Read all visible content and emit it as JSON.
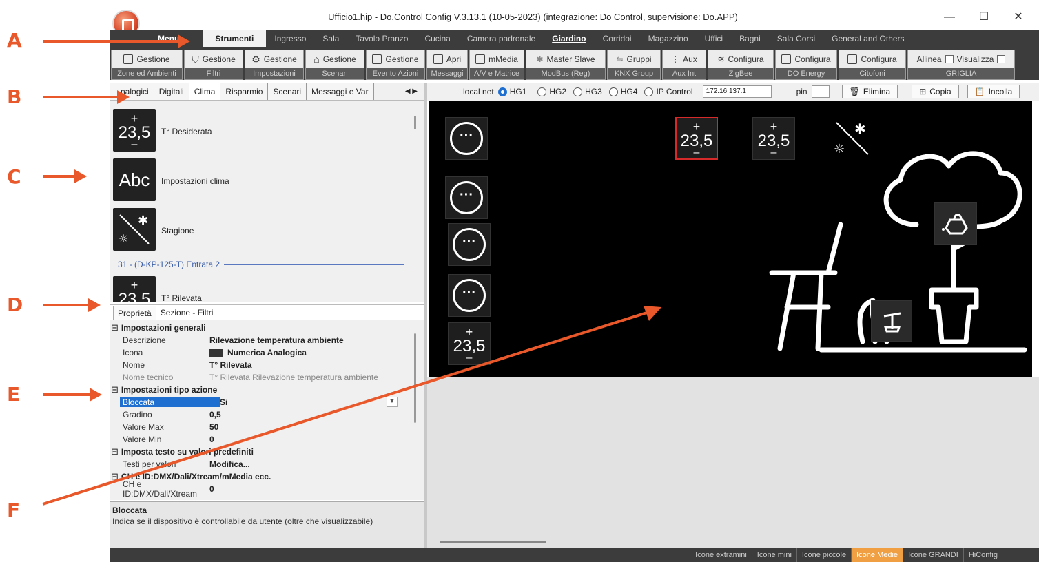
{
  "window": {
    "title": "Ufficio1.hip - Do.Control Config V.3.13.1 (10-05-2023) (integrazione: Do Control, supervisione: Do.APP)",
    "minimize": "—",
    "maximize": "☐",
    "close": "✕"
  },
  "callouts": [
    "A",
    "B",
    "C",
    "D",
    "E",
    "F"
  ],
  "menubar": {
    "menu": "Menu",
    "tabs": [
      "Strumenti",
      "Ingresso",
      "Sala",
      "Tavolo Pranzo",
      "Cucina",
      "Camera padronale",
      "Giardino",
      "Corridoi",
      "Magazzino",
      "Uffici",
      "Bagni",
      "Sala Corsi",
      "General and Others"
    ]
  },
  "toolbar": [
    {
      "top": "Gestione",
      "bottom": "Zone ed Ambienti",
      "icon": "grid-icon"
    },
    {
      "top": "Gestione",
      "bottom": "Filtri",
      "icon": "filter-icon"
    },
    {
      "top": "Gestione",
      "bottom": "Impostazioni",
      "icon": "gear-icon"
    },
    {
      "top": "Gestione",
      "bottom": "Scenari",
      "icon": "house-icon"
    },
    {
      "top": "Gestione",
      "bottom": "Evento Azioni",
      "icon": "event-icon"
    },
    {
      "top": "Apri",
      "bottom": "Messaggi",
      "icon": "message-icon"
    },
    {
      "top": "mMedia",
      "bottom": "A/V e Matrice",
      "icon": "media-icon"
    },
    {
      "top": "Master   Slave",
      "bottom": "ModBus (Reg)",
      "icon": "modbus-icon"
    },
    {
      "top": "Gruppi",
      "bottom": "KNX Group",
      "icon": "knx-icon"
    },
    {
      "top": "Aux",
      "bottom": "Aux Int",
      "icon": "aux-icon"
    },
    {
      "top": "Configura",
      "bottom": "ZigBee",
      "icon": "wifi-icon"
    },
    {
      "top": "Configura",
      "bottom": "DO Energy",
      "icon": "energy-icon"
    },
    {
      "top": "Configura",
      "bottom": "Citofoni",
      "icon": "intercom-icon"
    },
    {
      "top": "Allinea",
      "top2": "Visualizza",
      "bottom": "GRIGLIA",
      "icon": "checkbox"
    }
  ],
  "lefttabs": [
    "nalogici",
    "Digitali",
    "Clima",
    "Risparmio",
    "Scenari",
    "Messaggi e Var"
  ],
  "lefttabs_nav": "◀ ▶",
  "list": {
    "tile_number": "23,5",
    "tile_abc": "Abc",
    "items": [
      "T° Desiderata",
      "Impostazioni clima",
      "Stagione"
    ],
    "group_header": "31 - (D-KP-125-T) Entrata 2",
    "last_item": "T° Rilevata"
  },
  "proptabs": [
    "Proprietà",
    "Sezione - Filtri"
  ],
  "props": {
    "sec1": "Impostazioni generali",
    "descrizione_k": "Descrizione",
    "descrizione_v": "Rilevazione temperatura ambiente",
    "icona_k": "Icona",
    "icona_v": "Numerica Analogica",
    "nome_k": "Nome",
    "nome_v": "T° Rilevata",
    "nometec_k": "Nome tecnico",
    "nometec_v": "T° Rilevata Rilevazione temperatura ambiente",
    "sec2": "Impostazioni tipo azione",
    "bloccata_k": "Bloccata",
    "bloccata_v": "Si",
    "gradino_k": "Gradino",
    "gradino_v": "0,5",
    "vmax_k": "Valore Max",
    "vmax_v": "50",
    "vmin_k": "Valore Min",
    "vmin_v": "0",
    "sec3": "Imposta testo su valori predefiniti",
    "testi_k": "Testi per valori",
    "testi_v": "Modifica...",
    "sec4": "CH e ID:DMX/Dali/Xtream/mMedia ecc.",
    "ch_k": "CH e ID:DMX/Dali/Xtream",
    "ch_v": "0"
  },
  "desc": {
    "title": "Bloccata",
    "text": "Indica se il dispositivo è controllabile da utente (oltre che visualizzabile)"
  },
  "netbar": {
    "localnet": "local net",
    "options": [
      "HG1",
      "HG2",
      "HG3",
      "HG4",
      "IP Control"
    ],
    "selected": "HG1",
    "ip": "172.16.137.1",
    "pin_label": "pin",
    "delete": "Elimina",
    "copy": "Copia",
    "paste": "Incolla"
  },
  "canvas": {
    "number": "23,5",
    "dots": "···"
  },
  "statusbar": [
    "Icone extramini",
    "Icone mini",
    "Icone piccole",
    "Icone Medie",
    "Icone GRANDI",
    "HiConfig"
  ],
  "statusbar_active": "Icone Medie",
  "colors": {
    "accent": "#e8582a",
    "selection": "#1f6fd0",
    "status_active": "#f0a042",
    "dark": "#3c3c3c"
  }
}
